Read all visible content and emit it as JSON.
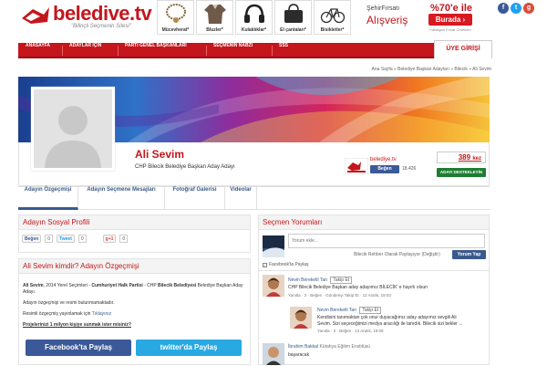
{
  "logo": {
    "name": "beledive.tv",
    "slogan": "\"Bilinçli Seçmenin Sitesi\""
  },
  "ad_products": [
    {
      "label": "Mücevherat*",
      "icon": "necklace-icon"
    },
    {
      "label": "Bluzler*",
      "icon": "blouse-icon"
    },
    {
      "label": "Kulaklıklar*",
      "icon": "headphones-icon"
    },
    {
      "label": "El çantaları*",
      "icon": "handbag-icon"
    },
    {
      "label": "Bisikletler*",
      "icon": "bicycle-icon"
    }
  ],
  "ad_promo": {
    "line1": "ŞehirFırsatı",
    "line2": "Alışveriş",
    "discount": "%70'e ile",
    "button": "Burada ›",
    "note": "*Yakalgan Fırsat Örnekleri"
  },
  "social": [
    {
      "icon": "facebook-icon",
      "glyph": "f",
      "color": "#3b5998"
    },
    {
      "icon": "twitter-icon",
      "glyph": "t",
      "color": "#1da1f2"
    },
    {
      "icon": "googleplus-icon",
      "glyph": "g",
      "color": "#dd4b39"
    }
  ],
  "nav": {
    "items": [
      "ANASAYFA",
      "ADAYLAR İÇİN",
      "PARTİ GENEL BAŞKANLARI",
      "SEÇMENİN NABZI",
      "SSS"
    ],
    "login": "ÜYE GİRİŞİ"
  },
  "breadcrumb": "Ana Sayfa » Belediye Başkan Adayları » Bilecik » Ali Sevim",
  "profile": {
    "name": "Ali Sevim",
    "description": "CHP Bilecik Belediye Başkan Aday Adayı",
    "page_name": "belediye.tv",
    "follow_label": "Beğen",
    "follow_count": "18.426",
    "vote_count": "389",
    "vote_unit": "kez",
    "vote_button": "ADAYI DESTEKLEYİN"
  },
  "tabs": [
    "Adayın Özgeçmişi",
    "Adayın Seçmene Mesajları",
    "Fotoğraf Galerisi",
    "Videolar"
  ],
  "social_panel": {
    "title": "Adayın Sosyal Profili",
    "like_label": "Beğen",
    "like_count": "0",
    "tweet_label": "Tweet",
    "tweet_count": "0",
    "gplus_label": "g+1",
    "gplus_count": "0"
  },
  "bio_panel": {
    "title": "Ali Sevim kimdir? Adayın Özgeçmişi",
    "p1_name": "Ali Sevim",
    "p1_text1": ", 2014 Yerel Seçimleri - ",
    "p1_party": "Cumhuriyet Halk Partisi",
    "p1_text2": " - CHP ",
    "p1_city": "Bilecik Belediyesi",
    "p1_text3": " Belediye Başkan Aday Adayı.",
    "p2": "Adayın özgeçmişi ve resmi bulunmamaktadır.",
    "p3_text": "Resimli özgeçmiş yayınlamak için ",
    "p3_link": "Tıklayınız",
    "question": "Projelerinizi 1 milyon kişiye sunmak ister misiniz?",
    "fb_share": "Facebook'ta Paylaş",
    "tw_share": "twitter'da Paylaş"
  },
  "comments_panel": {
    "title": "Seçmen Yorumları",
    "placeholder": "Yorum ekle...",
    "posting_as": "Bilecik Rehber Olarak Paylaşıyor (Değiştir)",
    "post_button": "Yorum Yap",
    "fb_checkbox": "Facebook'ta Paylaş",
    "comments": [
      {
        "author": "Nevin Bereketli Tan",
        "follow": "Takip Et",
        "text": "CHP Bilecik Belediye Başkan aday adayımız BİLECİK' e hayırlı olsun",
        "meta": "Yanıtla · 3 · Beğen · Gönderiyi Takip Et · 12 Aralık, 19:03"
      },
      {
        "author": "Nevin Bereketli Tan",
        "follow": "Takip Et",
        "text": "Kendisini tanımaktan çok onur duyacağımız aday adayımız sevgili Ali",
        "text2": "Sevim. Sizi seçeceğimizi medya aracılığı ile tanıdık. Bilecik sizi bekler ...",
        "meta": "Yanıtla · 3 · Beğen · 12 Aralık, 19:09"
      },
      {
        "author": "İbrahim Bakkal",
        "follow": "Kütahya Eğitim Enstitüsü",
        "text": "başaracak",
        "meta": ""
      }
    ]
  }
}
